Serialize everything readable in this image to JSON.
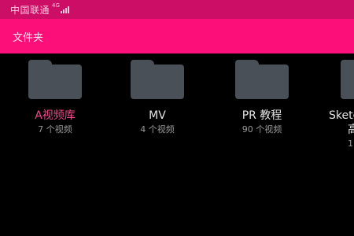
{
  "status_bar": {
    "carrier": "中国联通",
    "network": "4G",
    "background": "#cc0e66"
  },
  "app_bar": {
    "title": "文件夹",
    "background": "#fc0f79"
  },
  "folders": [
    {
      "name": "A视频库",
      "count": "7 个视频",
      "icon": "folder-icon",
      "selected": true
    },
    {
      "name": "MV",
      "count": "4 个视频",
      "icon": "folder-icon",
      "selected": false
    },
    {
      "name": "PR 教程",
      "count": "90 个视频",
      "icon": "folder-icon",
      "selected": false
    },
    {
      "name_line1": "Sketc",
      "name_line2": "高",
      "count": "1",
      "icon": "folder-icon",
      "selected": false
    }
  ],
  "colors": {
    "accent": "#fc0f79",
    "selected_text": "#f04a8a",
    "folder_icon": "#4a5057"
  }
}
